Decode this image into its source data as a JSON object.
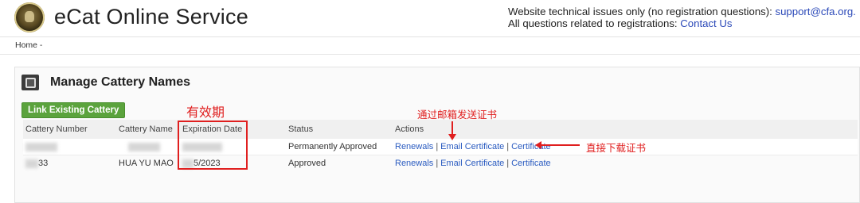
{
  "header": {
    "brand": "eCat Online Service",
    "tech_label": "Website technical issues only (no registration questions): ",
    "tech_email": "support@cfa.org.",
    "reg_label": "All questions related to registrations: ",
    "reg_link": "Contact Us"
  },
  "breadcrumb": "Home -",
  "panel": {
    "title": "Manage Cattery Names",
    "button": "Link Existing Cattery"
  },
  "table": {
    "columns": [
      "Cattery Number",
      "Cattery Name",
      "Expiration Date",
      "Status",
      "Actions"
    ],
    "rows": [
      {
        "number": "",
        "name": "",
        "expiration": "",
        "status": "Permanently Approved",
        "renewals": "Renewals",
        "email_cert": "Email Certificate",
        "certificate": "Certificate"
      },
      {
        "number": "33",
        "name": "HUA YU MAO",
        "expiration": "5/2023",
        "status": "Approved",
        "renewals": "Renewals",
        "email_cert": "Email Certificate",
        "certificate": "Certificate"
      }
    ],
    "separator": "|"
  },
  "annotations": {
    "validity": "有效期",
    "email_send": "通过邮箱发送证书",
    "direct_download": "直接下载证书"
  },
  "colors": {
    "link": "#2a5bc0",
    "button_green": "#5ba33d",
    "annotation_red": "#e01f1f"
  },
  "icons": {
    "logo": "cfa-seal-logo",
    "panel": "cattery-card-icon"
  }
}
